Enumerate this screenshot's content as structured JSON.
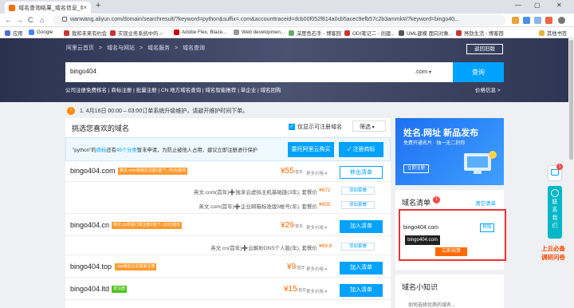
{
  "browser": {
    "tab_title": "域名查询结果_域名信息_域名注册...",
    "tab_close": "×",
    "new_tab": "+",
    "url": "wanwang.aliyun.com/domain/searchresult/?keyword=python&suffix=.com&accounttraceid=dcb00f052f814a0cb5acec9efb57c2b3ammk#/?keyword=bingo40...",
    "window_controls": [
      "—",
      "▢",
      "✕"
    ],
    "nav": [
      "←",
      "→",
      "C",
      "⌂"
    ],
    "bookmarks": [
      {
        "label": "应用",
        "color": "#4a6fd8"
      },
      {
        "label": "Google",
        "color": "#4285f4"
      },
      {
        "label": "我和未来有约会 ...",
        "color": "#c33"
      },
      {
        "label": "实现业务系统中的...",
        "color": "#c33"
      },
      {
        "label": "...",
        "color": "#888"
      },
      {
        "label": "Adobe Flex, Blaze...",
        "color": "#c00"
      },
      {
        "label": "Web developmen...",
        "color": "#999"
      },
      {
        "label": "深度色石手 - 博客园",
        "color": "#6a6"
      },
      {
        "label": "ODI笔记二 - 创建...",
        "color": "#c33"
      },
      {
        "label": "UML建模 面向对象...",
        "color": "#555"
      },
      {
        "label": "亮劲生活 - 博客园",
        "color": "#c33"
      },
      {
        "label": "其他书签",
        "color": "#e8b23a"
      }
    ]
  },
  "header": {
    "breadcrumb": [
      "阿里云首页",
      ">",
      "域名与网站",
      ">",
      "域名服务",
      ">",
      "域名查询"
    ],
    "feedback": "返回旧版",
    "search_value": "bingo404",
    "suffix": ".com",
    "search_button": "查询",
    "quick_links": "公司注册免费核名 | 商标注册 | 批量注册 | CN 地方域名查询 | 域名智能推荐 | 单企业 | 域名回购",
    "price_link": "价格信息 >"
  },
  "notice": {
    "icon": "!",
    "text": "1. 4月16日 00:00 – 03:00订单系统升级维护，请避开维护时间下单。"
  },
  "main": {
    "title": "挑选您喜欢的域名",
    "only_registrable": "仅显示可注册域名",
    "filter": "筛选",
    "tm_prefix": "\"python\"的",
    "tm_hl1": "商标",
    "tm_mid": "还有",
    "tm_hl2": "45个分类",
    "tm_suffix": "暂未申请，为防止被他人占用，建议立即注册进行保护",
    "btn_commission": "委托阿里云购买",
    "btn_trademark": "注册商标",
    "domains": [
      {
        "name": "bingo404.com",
        "badge": "英文.com单组日注册2首个, 45元/首年",
        "badge_color": "#ff9a2e",
        "price": "55",
        "unit": "首年",
        "more": "更多价格 ▾",
        "button": "移出清单",
        "btn_style": "out"
      },
      {
        "name": "bingo404.cn",
        "badge": "英文.cn单组订单注册2首个, 18元/首年",
        "badge_color": "#ff9a2e",
        "price": "29",
        "unit": "首年",
        "more": "更多价格 ▾",
        "button": "加入清单",
        "btn_style": "add"
      },
      {
        "name": "bingo404.top",
        "badge": ".top域名以文独家注册",
        "badge_color": "#ff9a2e",
        "price": "9",
        "unit": "首年",
        "more": "更多价格 ▾",
        "button": "加入清单",
        "btn_style": "add"
      },
      {
        "name": "bingo404.ltd",
        "badge": "未注册",
        "badge_color": "#52c41a",
        "price": "15",
        "unit": "首年",
        "more": "更多价格 ▾",
        "button": "加入清单",
        "btn_style": "add"
      }
    ],
    "bundles": [
      {
        "text": "英文.com(首年)➕独享云虚拟主机基础版(3年), 套餐价",
        "price": "¥672",
        "button": "添加套餐"
      },
      {
        "text": "英文.com(首年)➕企业邮箱标准版5帐号(年), 套餐价",
        "price": "¥655",
        "button": "添加套餐"
      },
      {
        "text": "英文.cn(首年)➕云解析DNS个人版(年), 套餐价",
        "price": "¥69.8",
        "button": "添加套餐"
      }
    ]
  },
  "ad": {
    "title": "姓名.网址 新品发布",
    "subtitle": "免费开通名片 · 独一无二的你",
    "button": "立即注册"
  },
  "cart": {
    "title": "域名清单",
    "count": "1",
    "clear": "清空清单",
    "item": "bingo404.com",
    "remove": "移除",
    "tooltip": "bingo404.com",
    "buy": "立即结算"
  },
  "knowledge": {
    "title": "域名小知识",
    "line": "如何选择优质的域名..."
  },
  "float": {
    "cart_count": "1",
    "contact": [
      "联",
      "系",
      "我",
      "们"
    ],
    "promo_line1": "上云必备",
    "promo_line2": "调研问卷"
  }
}
